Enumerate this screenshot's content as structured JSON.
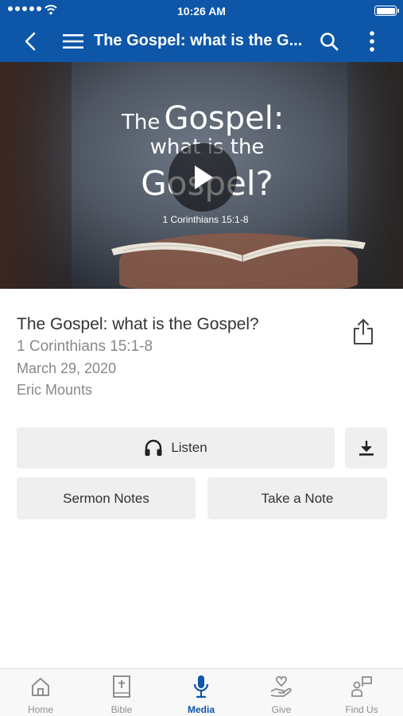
{
  "status_bar": {
    "time": "10:26 AM"
  },
  "nav": {
    "title": "The Gospel: what is the G..."
  },
  "hero": {
    "line1_small": "The",
    "line1_big": "Gospel:",
    "line2": "what is the",
    "line3": "Gospel?",
    "reference": "1 Corinthians 15:1-8"
  },
  "sermon": {
    "title": "The Gospel: what is the Gospel?",
    "scripture": "1 Corinthians 15:1-8",
    "date": "March 29, 2020",
    "speaker": "Eric Mounts"
  },
  "actions": {
    "listen": "Listen",
    "sermon_notes": "Sermon Notes",
    "take_note": "Take a Note"
  },
  "tabs": [
    {
      "label": "Home",
      "icon": "home-icon"
    },
    {
      "label": "Bible",
      "icon": "bible-icon"
    },
    {
      "label": "Media",
      "icon": "microphone-icon",
      "active": true
    },
    {
      "label": "Give",
      "icon": "give-icon"
    },
    {
      "label": "Find Us",
      "icon": "find-us-icon"
    }
  ],
  "colors": {
    "brand": "#0d56a8",
    "button_bg": "#efefef",
    "inactive_tab": "#8e8e8e"
  }
}
